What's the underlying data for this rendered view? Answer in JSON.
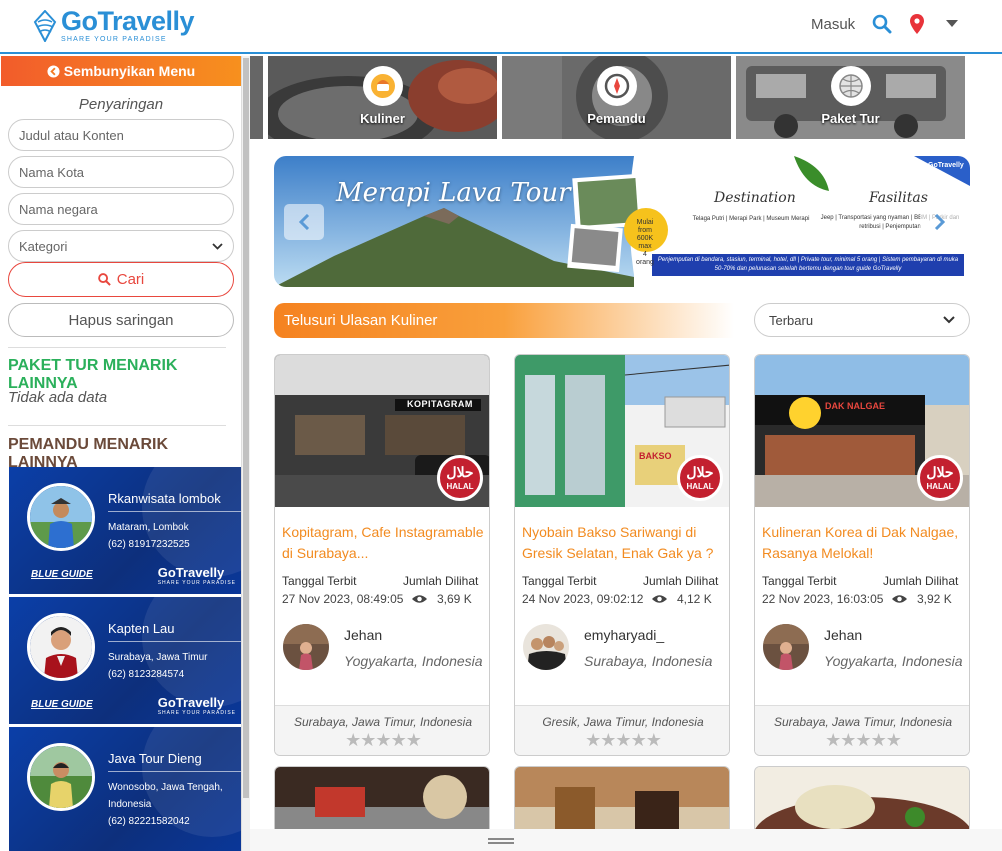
{
  "header": {
    "brand": "GoTravelly",
    "tagline": "SHARE YOUR PARADISE",
    "login_label": "Masuk",
    "icons": [
      "search-icon",
      "location-pin-icon",
      "caret-down-icon"
    ],
    "brand_color": "#2a8fd6"
  },
  "sidebar": {
    "hide_menu_label": "Sembunyikan Menu",
    "filter_title": "Penyaringan",
    "fields": {
      "title_placeholder": "Judul atau Konten",
      "city_placeholder": "Nama Kota",
      "country_placeholder": "Nama negara",
      "category_value": "Kategori"
    },
    "search_button": "Cari",
    "reset_button": "Hapus saringan",
    "tour_section_title": "PAKET TUR MENARIK LAINNYA",
    "tour_empty": "Tidak ada data",
    "guide_section_title": "PEMANDU MENARIK LAINNYA",
    "guides": [
      {
        "name": "Rkanwisata lombok",
        "location": "Mataram, Lombok",
        "phone": "(62) 81917232525",
        "badge": "BLUE GUIDE",
        "brand": "GoTravelly"
      },
      {
        "name": "Kapten Lau",
        "location": "Surabaya, Jawa Timur",
        "phone": "(62) 8123284574",
        "badge": "BLUE GUIDE",
        "brand": "GoTravelly"
      },
      {
        "name": "Java Tour Dieng",
        "location": "Wonosobo, Jawa Tengah, Indonesia",
        "phone": "(62) 82221582042",
        "badge": "BLUE GUIDE",
        "brand": "GoTravelly"
      }
    ]
  },
  "categories": [
    {
      "label": "Kuliner",
      "icon": "food-icon"
    },
    {
      "label": "Pemandu",
      "icon": "compass-icon"
    },
    {
      "label": "Paket Tur",
      "icon": "globe-icon"
    }
  ],
  "banner": {
    "title": "Merapi Lava Tour",
    "destination_heading": "Destination",
    "destination_text": "Telaga Putri | Merapi Park | Museum Merapi",
    "facility_heading": "Fasilitas",
    "facility_text": "Jeep | Transportasi yang nyaman | BBM | Parkir dan retribusi | Penjemputan",
    "price_text": "Mulai from 600K max 4 orang",
    "note": "Penjemputan di bandara, stasiun, terminal, hotel, dll | Private tour, minimal 5 orang | Sistem pembayaran di muka 50-70% dan pelunasan setelah bertemu dengan tour guide GoTravelly"
  },
  "explore": {
    "title": "Telusuri Ulasan Kuliner",
    "sort_value": "Terbaru"
  },
  "posts": [
    {
      "title": "Kopitagram, Cafe Instagramable di Surabaya...",
      "published_label": "Tanggal Terbit",
      "views_label": "Jumlah Dilihat",
      "published": "27 Nov 2023, 08:49:05",
      "views": "3,69 K",
      "author": "Jehan",
      "author_location": "Yogyakarta, Indonesia",
      "place": "Surabaya, Jawa Timur, Indonesia",
      "halal": "HALAL",
      "sign_text": "KOPITAGRAM"
    },
    {
      "title": "Nyobain Bakso Sariwangi di Gresik Selatan, Enak Gak ya ?",
      "published_label": "Tanggal Terbit",
      "views_label": "Jumlah Dilihat",
      "published": "24 Nov 2023, 09:02:12",
      "views": "4,12 K",
      "author": "emyharyadi_",
      "author_location": "Surabaya, Indonesia",
      "place": "Gresik, Jawa Timur, Indonesia",
      "halal": "HALAL",
      "sign_text": "BAKSO"
    },
    {
      "title": "Kulineran Korea di Dak Nalgae, Rasanya Melokal!",
      "published_label": "Tanggal Terbit",
      "views_label": "Jumlah Dilihat",
      "published": "22 Nov 2023, 16:03:05",
      "views": "3,92 K",
      "author": "Jehan",
      "author_location": "Yogyakarta, Indonesia",
      "place": "Surabaya, Jawa Timur, Indonesia",
      "halal": "HALAL",
      "sign_text": "DAK NALGAE"
    }
  ],
  "rating": {
    "stars": 5,
    "filled": 0
  },
  "colors": {
    "accent_orange": "#f28b20",
    "green": "#2bb05b",
    "guide_blue": "#0b3fa8",
    "halal_red": "#c3202f"
  }
}
